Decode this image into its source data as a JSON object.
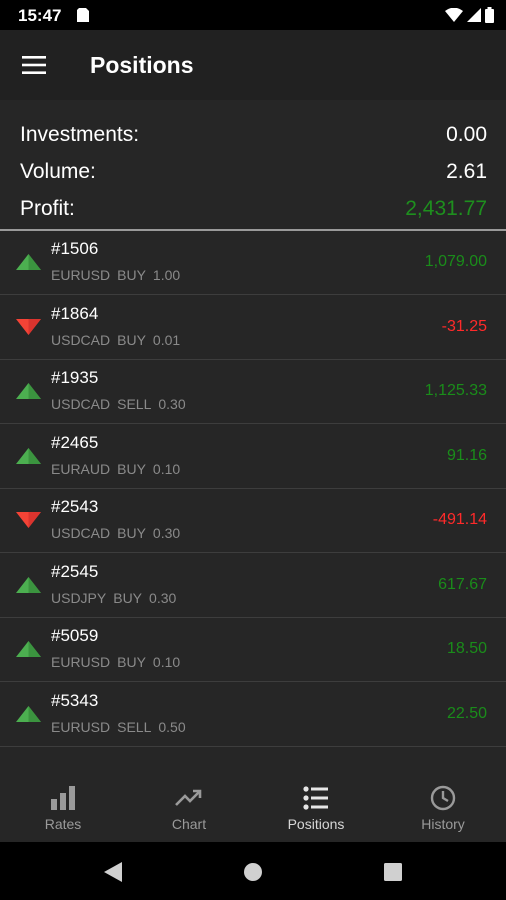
{
  "status_bar": {
    "time": "15:47",
    "icons": [
      "sim-card-icon",
      "wifi-icon",
      "signal-icon",
      "battery-icon"
    ]
  },
  "app_bar": {
    "menu_icon": "hamburger-menu-icon",
    "title": "Positions"
  },
  "summary": {
    "investments_label": "Investments:",
    "investments_value": "0.00",
    "volume_label": "Volume:",
    "volume_value": "2.61",
    "profit_label": "Profit:",
    "profit_value": "2,431.77"
  },
  "positions": [
    {
      "id": "#1506",
      "symbol": "EURUSD",
      "side": "BUY",
      "volume": "1.00",
      "profit": "1,079.00",
      "direction": "up"
    },
    {
      "id": "#1864",
      "symbol": "USDCAD",
      "side": "BUY",
      "volume": "0.01",
      "profit": "-31.25",
      "direction": "down"
    },
    {
      "id": "#1935",
      "symbol": "USDCAD",
      "side": "SELL",
      "volume": "0.30",
      "profit": "1,125.33",
      "direction": "up"
    },
    {
      "id": "#2465",
      "symbol": "EURAUD",
      "side": "BUY",
      "volume": "0.10",
      "profit": "91.16",
      "direction": "up"
    },
    {
      "id": "#2543",
      "symbol": "USDCAD",
      "side": "BUY",
      "volume": "0.30",
      "profit": "-491.14",
      "direction": "down"
    },
    {
      "id": "#2545",
      "symbol": "USDJPY",
      "side": "BUY",
      "volume": "0.30",
      "profit": "617.67",
      "direction": "up"
    },
    {
      "id": "#5059",
      "symbol": "EURUSD",
      "side": "BUY",
      "volume": "0.10",
      "profit": "18.50",
      "direction": "up"
    },
    {
      "id": "#5343",
      "symbol": "EURUSD",
      "side": "SELL",
      "volume": "0.50",
      "profit": "22.50",
      "direction": "up"
    }
  ],
  "bottom_nav": {
    "items": [
      {
        "label": "Rates",
        "icon": "bar-chart-icon",
        "active": false
      },
      {
        "label": "Chart",
        "icon": "trending-up-icon",
        "active": false
      },
      {
        "label": "Positions",
        "icon": "list-icon",
        "active": true
      },
      {
        "label": "History",
        "icon": "clock-icon",
        "active": false
      }
    ]
  },
  "system_nav": {
    "buttons": [
      "back-icon",
      "home-icon",
      "recents-icon"
    ]
  },
  "colors": {
    "profit_up": "#1a8c1a",
    "profit_down": "#ff2a2a",
    "arrow_up": "#4caf50",
    "arrow_down": "#f44336"
  }
}
